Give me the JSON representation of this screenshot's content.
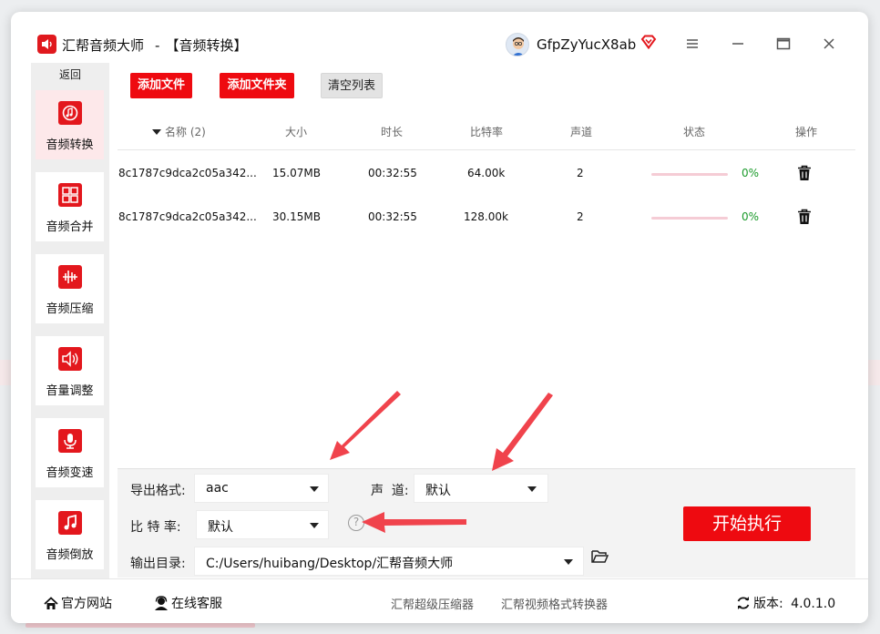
{
  "window": {
    "app_name": "汇帮音频大师",
    "separator": "-",
    "module_title": "【音频转换】",
    "username": "GfpZyYucX8ab"
  },
  "sidebar": {
    "back_label": "返回",
    "items": [
      {
        "label": "音频转换",
        "icon": "audio-convert-icon",
        "active": true
      },
      {
        "label": "音频合并",
        "icon": "audio-merge-icon",
        "active": false
      },
      {
        "label": "音频压缩",
        "icon": "audio-compress-icon",
        "active": false
      },
      {
        "label": "音量调整",
        "icon": "volume-icon",
        "active": false
      },
      {
        "label": "音频变速",
        "icon": "microphone-icon",
        "active": false
      },
      {
        "label": "音频倒放",
        "icon": "music-note-icon",
        "active": false
      }
    ]
  },
  "toolbar": {
    "add_file": "添加文件",
    "add_folder": "添加文件夹",
    "clear_list": "清空列表"
  },
  "table": {
    "headers": {
      "name": "名称 (2)",
      "size": "大小",
      "duration": "时长",
      "bitrate": "比特率",
      "channels": "声道",
      "status": "状态",
      "actions": "操作"
    },
    "rows": [
      {
        "name": "8c1787c9dca2c05a342...",
        "size": "15.07MB",
        "duration": "00:32:55",
        "bitrate": "64.00k",
        "channels": "2",
        "progress": 0,
        "percent": "0%"
      },
      {
        "name": "8c1787c9dca2c05a342...",
        "size": "30.15MB",
        "duration": "00:32:55",
        "bitrate": "128.00k",
        "channels": "2",
        "progress": 0,
        "percent": "0%"
      }
    ]
  },
  "settings": {
    "format_label": "导出格式:",
    "format_value": "aac",
    "channel_label": "声  道:",
    "channel_value": "默认",
    "bitrate_label": "比 特 率:",
    "bitrate_value": "默认",
    "help": "?",
    "output_label": "输出目录:",
    "output_value": "C:/Users/huibang/Desktop/汇帮音频大师",
    "start_button": "开始执行"
  },
  "statusbar": {
    "website": "官方网站",
    "support": "在线客服",
    "link1": "汇帮超级压缩器",
    "link2": "汇帮视频格式转换器",
    "version_label": "版本:",
    "version_value": "4.0.1.0"
  },
  "colors": {
    "accent": "#ee0a10",
    "progress_track": "#f5ccd5",
    "percent_text": "#1a9a2a",
    "active_nav": "#fde8ea"
  }
}
